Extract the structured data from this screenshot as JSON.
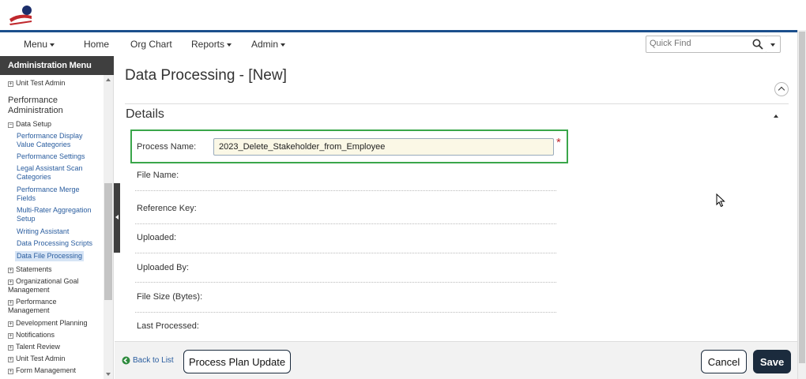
{
  "nav": {
    "menu": "Menu",
    "home": "Home",
    "org_chart": "Org Chart",
    "reports": "Reports",
    "admin": "Admin",
    "quick_find_placeholder": "Quick Find"
  },
  "sidebar": {
    "header": "Administration Menu",
    "unit_test_admin_top": "Unit Test Admin",
    "section": "Performance Administration",
    "data_setup": "Data Setup",
    "links": [
      "Performance Display Value Categories",
      "Performance Settings",
      "Legal Assistant Scan Categories",
      "Performance Merge Fields",
      "Multi-Rater Aggregation Setup",
      "Writing Assistant",
      "Data Processing Scripts",
      "Data File Processing"
    ],
    "groups": [
      "Statements",
      "Organizational Goal Management",
      "Performance Management",
      "Development Planning",
      "Notifications",
      "Talent Review",
      "Unit Test Admin",
      "Form Management"
    ]
  },
  "main": {
    "title": "Data Processing - [New]",
    "details": "Details",
    "fields": {
      "process_name_label": "Process Name:",
      "process_name_value": "2023_Delete_Stakeholder_from_Employee",
      "required_mark": "*",
      "file_name_label": "File Name:",
      "reference_key_label": "Reference Key:",
      "uploaded_label": "Uploaded:",
      "uploaded_by_label": "Uploaded By:",
      "file_size_label": "File Size (Bytes):",
      "last_processed_label": "Last Processed:"
    }
  },
  "footer": {
    "back_to_list": "Back to List",
    "process_plan_update": "Process Plan Update",
    "cancel": "Cancel",
    "save": "Save"
  },
  "colors": {
    "brand_blue": "#1b4f8c",
    "highlight_green": "#3aa64a",
    "sidebar_header": "#3f3f3f",
    "save_button": "#1b2b3d"
  }
}
